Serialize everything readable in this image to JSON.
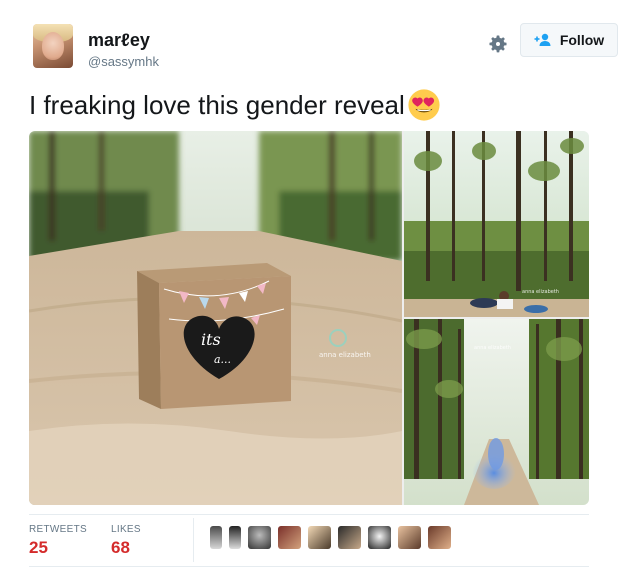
{
  "user": {
    "display_name": "marℓey",
    "handle": "@sassymhk",
    "avatar_icon": "user-avatar"
  },
  "actions": {
    "settings_icon": "gear-icon",
    "follow_label": "Follow",
    "follow_icon": "add-user-icon"
  },
  "tweet": {
    "text": "I freaking love this gender reveal",
    "emoji": "heart-eyes-emoji"
  },
  "media": {
    "photos": [
      {
        "name": "gender-reveal-box-photo",
        "box_text_line1": "its",
        "box_text_line2": "a...",
        "watermark": "anna elizabeth"
      },
      {
        "name": "couple-in-forest-photo",
        "watermark": "anna elizabeth"
      },
      {
        "name": "blue-smoke-reveal-photo",
        "watermark": "anna elizabeth"
      }
    ]
  },
  "stats": {
    "retweets_label": "RETWEETS",
    "retweets_value": "25",
    "likes_label": "LIKES",
    "likes_value": "68"
  },
  "colors": {
    "stat_value": "#d42b2b",
    "muted_text": "#657786",
    "border": "#e1e8ed"
  },
  "likers": [
    {
      "name": "liker-avatar-1"
    },
    {
      "name": "liker-avatar-2"
    },
    {
      "name": "liker-avatar-3"
    },
    {
      "name": "liker-avatar-4"
    },
    {
      "name": "liker-avatar-5"
    },
    {
      "name": "liker-avatar-6"
    },
    {
      "name": "liker-avatar-7"
    },
    {
      "name": "liker-avatar-8"
    },
    {
      "name": "liker-avatar-9"
    }
  ]
}
